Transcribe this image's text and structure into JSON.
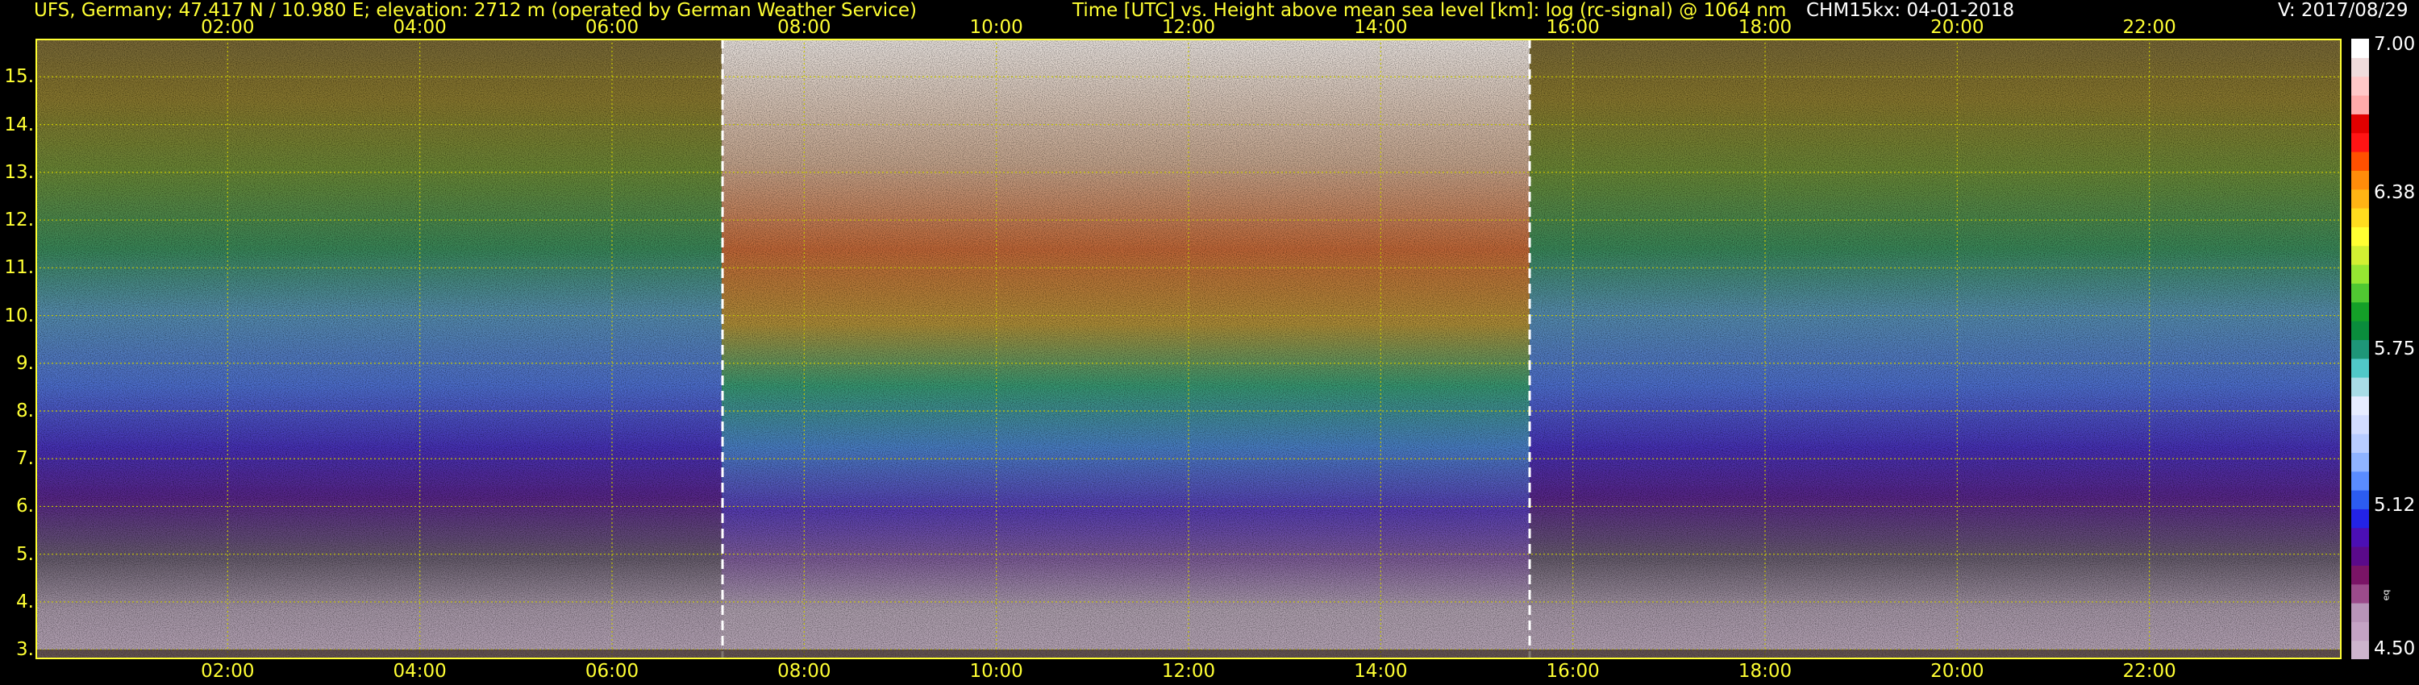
{
  "header": {
    "station": "UFS, Germany; 47.417 N / 10.980 E; elevation: 2712 m  (operated by German Weather Service)",
    "title": "Time [UTC] vs. Height above mean sea level [km]: log (rc-signal) @ 1064 nm",
    "instrument": "CHM15kx: 04-01-2018",
    "version": "V: 2017/08/29"
  },
  "colors": {
    "text_accent": "#ffff33",
    "grid": "#c8c800",
    "frame": "#ffff33",
    "marker_lines": "#ffffff",
    "background": "#000000"
  },
  "chart_data": {
    "type": "heatmap",
    "title": "Time [UTC] vs. Height above mean sea level [km]: log (rc-signal) @ 1064 nm",
    "xlabel": "Time [UTC]",
    "ylabel": "Height above mean sea level [km]",
    "x_unit": "hour UTC",
    "xlim": [
      0,
      24
    ],
    "ylim": [
      2.8,
      15.8
    ],
    "x_ticks": [
      2,
      4,
      6,
      8,
      10,
      12,
      14,
      16,
      18,
      20,
      22
    ],
    "x_tick_labels": [
      "02:00",
      "04:00",
      "06:00",
      "08:00",
      "10:00",
      "12:00",
      "14:00",
      "16:00",
      "18:00",
      "20:00",
      "22:00"
    ],
    "y_ticks": [
      3,
      4,
      5,
      6,
      7,
      8,
      9,
      10,
      11,
      12,
      13,
      14,
      15
    ],
    "y_tick_labels": [
      "3.",
      "4.",
      "5.",
      "6.",
      "7.",
      "8.",
      "9.",
      "10.",
      "11.",
      "12.",
      "13.",
      "14.",
      "15."
    ],
    "grid": true,
    "vertical_markers_hours": [
      7.15,
      15.55
    ],
    "colorbar": {
      "min": 4.5,
      "max": 7.0,
      "tick_values": [
        4.5,
        5.12,
        5.75,
        6.38,
        7.0
      ],
      "tick_labels": [
        "4.50",
        "5.12",
        "5.75",
        "6.38",
        "7.00"
      ],
      "label": "eq",
      "colors": [
        "#cdb5cd",
        "#c4a3c4",
        "#b894b8",
        "#9b4b8b",
        "#7a1466",
        "#5a0a8a",
        "#4b0fb4",
        "#2323e6",
        "#2c5cf0",
        "#5a8cff",
        "#8fb3ff",
        "#b8ccff",
        "#d2dcff",
        "#e6ecff",
        "#a8dce6",
        "#50c8c8",
        "#1e9678",
        "#0a8c3c",
        "#14a028",
        "#50c832",
        "#96e632",
        "#d2f032",
        "#ffff32",
        "#ffdc1e",
        "#ffb414",
        "#ff8c0a",
        "#ff5000",
        "#ff1414",
        "#e10000",
        "#ffaaaa",
        "#ffc8c8",
        "#f0dcdc",
        "#ffffff"
      ]
    }
  }
}
